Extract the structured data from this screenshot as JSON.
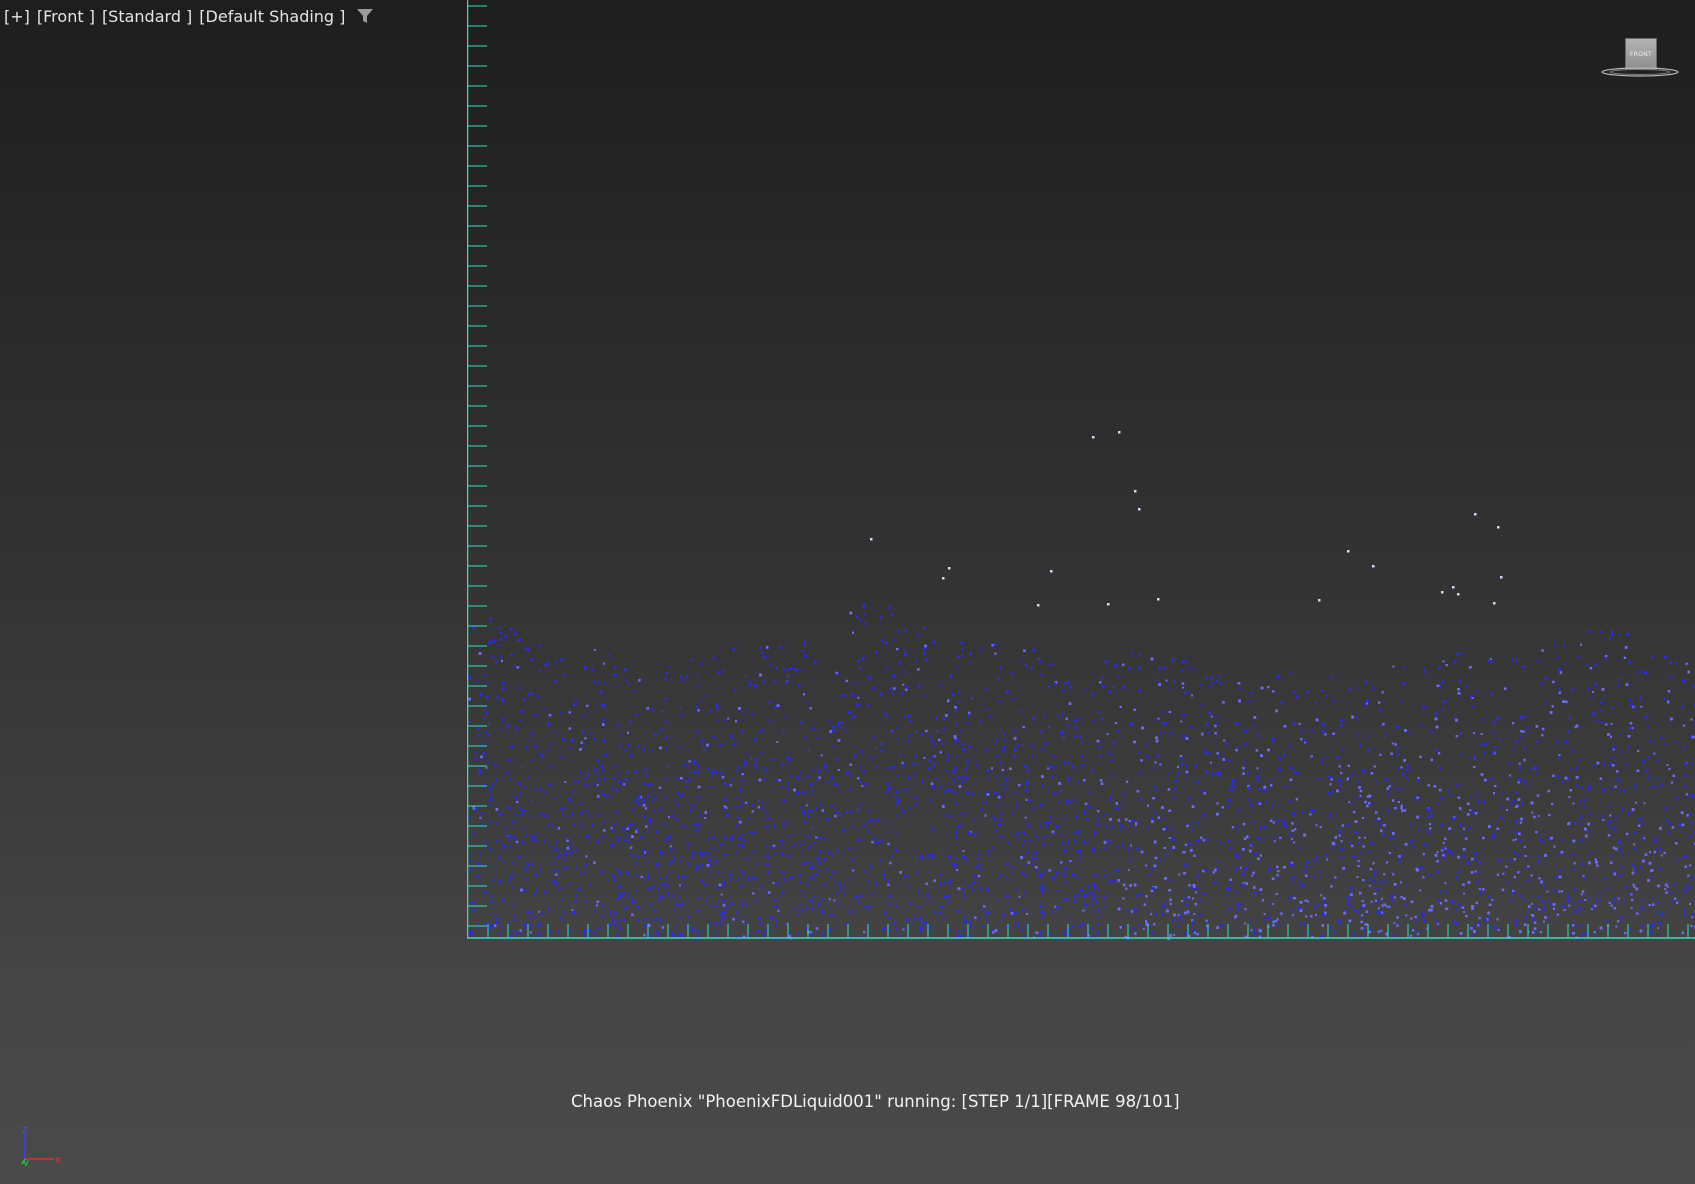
{
  "viewport": {
    "labels": [
      "[+]",
      "[Front ]",
      "[Standard ]",
      "[Default Shading ]"
    ],
    "filter_icon": "filter-icon",
    "viewcube_label": "FRONT",
    "status_text": "Chaos Phoenix \"PhoenixFDLiquid001\" running: [STEP 1/1][FRAME 98/101]",
    "axis_labels": {
      "z": "z",
      "y": "y",
      "x": "x"
    }
  },
  "colors": {
    "container_outline": "#2fe0c0",
    "particle_primary": "#2a2af0",
    "particle_light": "#6b6bff",
    "particle_spray": "#d8d8ff",
    "axis_z": "#3b3bff",
    "axis_y": "#2ecc40",
    "axis_x": "#e03030"
  }
}
